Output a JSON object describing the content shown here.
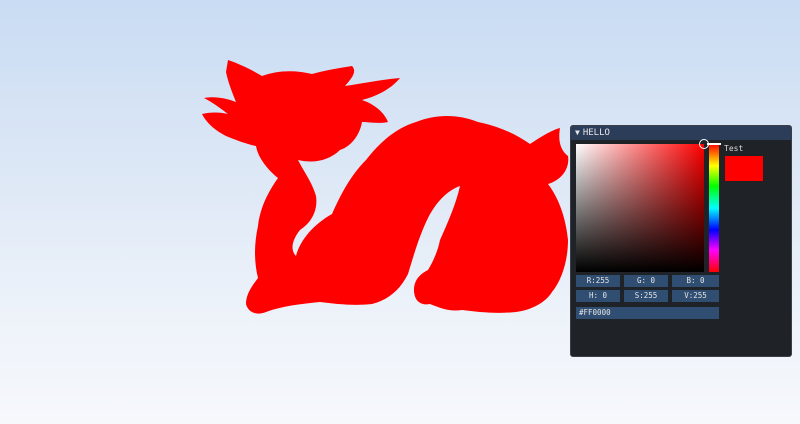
{
  "window": {
    "title": "HELLO",
    "collapse_icon": "triangle-down-icon"
  },
  "color_picker": {
    "label": "Test",
    "hex": "#FF0000",
    "r": "R:255",
    "g": "G:  0",
    "b": "B:  0",
    "h": "H:  0",
    "s": "S:255",
    "v": "V:255",
    "hue_fraction": 0,
    "saturation_fraction": 1,
    "value_fraction": 1
  },
  "scene": {
    "model": "dragon-silhouette",
    "model_color": "#ff0000"
  }
}
